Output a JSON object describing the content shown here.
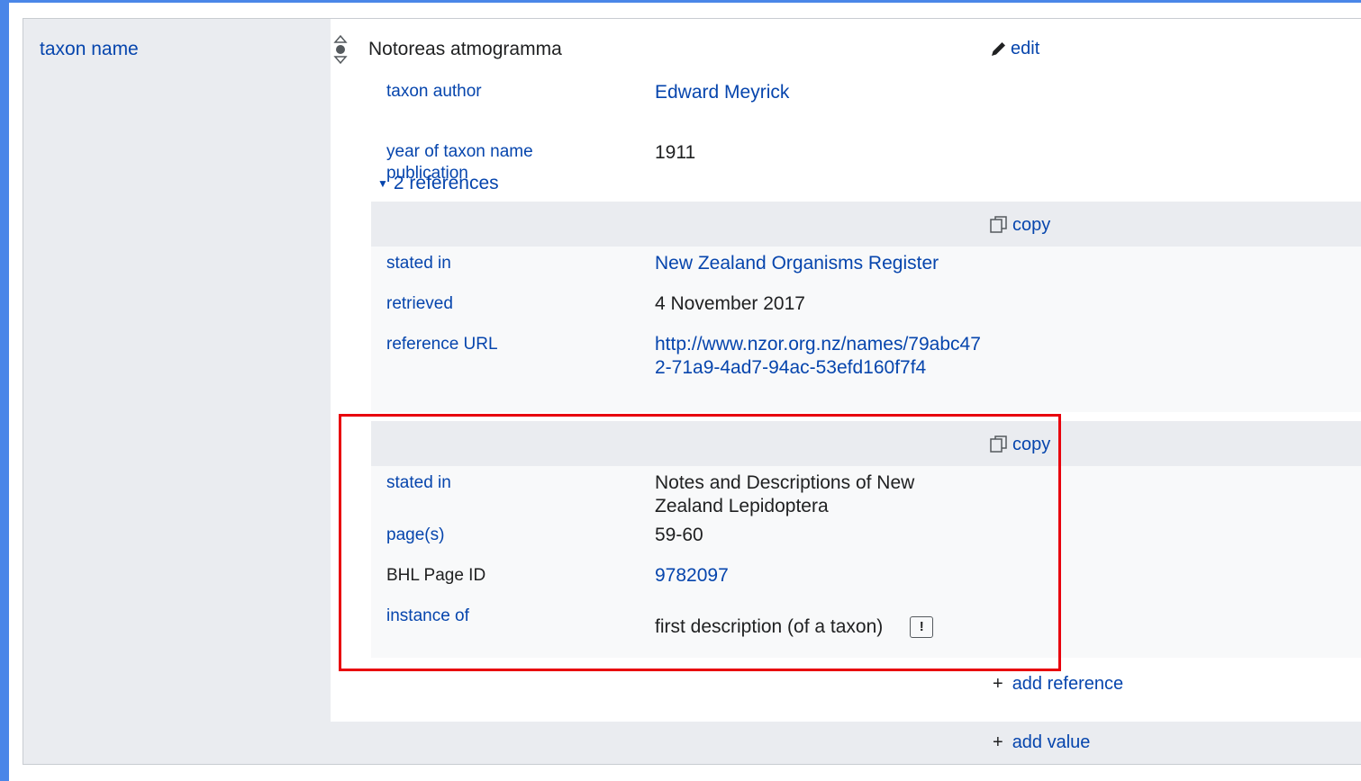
{
  "property": {
    "name": "taxon name"
  },
  "statement": {
    "value": "Notoreas atmogramma",
    "edit_label": "edit",
    "qualifiers": [
      {
        "label": "taxon author",
        "value": "Edward Meyrick"
      },
      {
        "label": "year of taxon name publication",
        "value": "1911"
      }
    ],
    "references_toggle": "2 references",
    "references": [
      {
        "copy_label": "copy",
        "snaks": [
          {
            "label": "stated in",
            "value": "New Zealand Organisms Register"
          },
          {
            "label": "retrieved",
            "value": "4 November 2017"
          },
          {
            "label": "reference URL",
            "value": "http://www.nzor.org.nz/names/79abc472-71a9-4ad7-94ac-53efd160f7f4"
          }
        ]
      },
      {
        "copy_label": "copy",
        "snaks": [
          {
            "label": "stated in",
            "value": "Notes and Descriptions of New Zealand Lepidoptera"
          },
          {
            "label": "page(s)",
            "value": "59-60"
          },
          {
            "label": "BHL Page ID",
            "value": "9782097"
          },
          {
            "label": "instance of",
            "value": "first description (of a taxon)"
          }
        ]
      }
    ],
    "add_reference_label": "add reference"
  },
  "add_value_label": "add value",
  "icons": {
    "rank": "rank-normal-icon",
    "edit": "pencil-icon",
    "copy": "copy-icon",
    "toggle": "triangle-down-icon",
    "warning": "exclamation-icon"
  },
  "colors": {
    "link": "#0645ad",
    "text": "#202122",
    "highlight": "#e8000d",
    "frame": "#4a86e8"
  }
}
